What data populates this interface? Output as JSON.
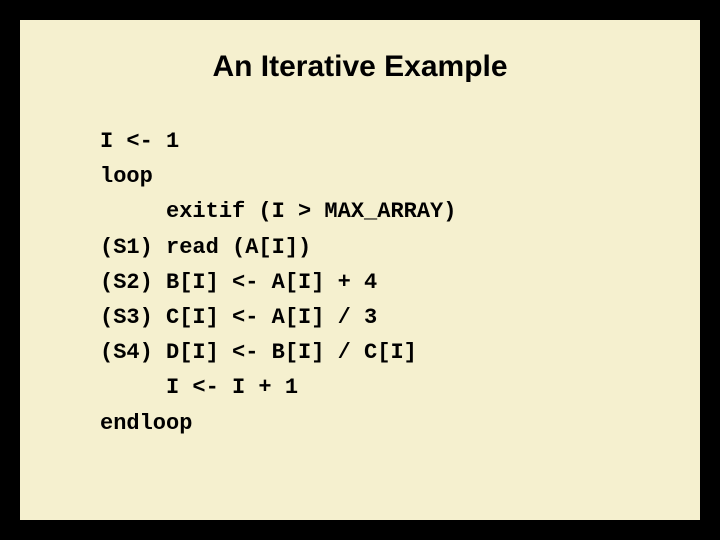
{
  "title": "An Iterative Example",
  "code": {
    "l1": "I <- 1",
    "l2": "loop",
    "l3": "     exitif (I > MAX_ARRAY)",
    "l4": "(S1) read (A[I])",
    "l5": "(S2) B[I] <- A[I] + 4",
    "l6": "(S3) C[I] <- A[I] / 3",
    "l7": "(S4) D[I] <- B[I] / C[I]",
    "l8": "     I <- I + 1",
    "l9": "endloop"
  }
}
